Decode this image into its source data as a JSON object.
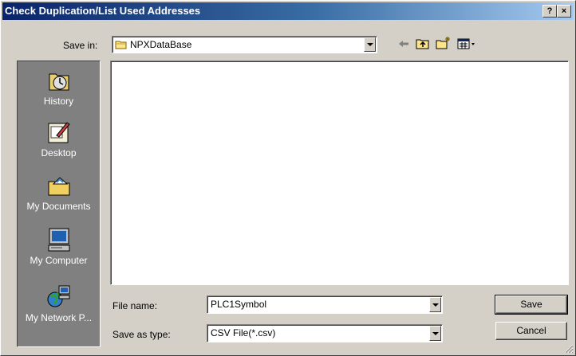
{
  "window": {
    "title": "Check Duplication/List Used Addresses",
    "help_button": "?",
    "close_button": "×"
  },
  "save_in": {
    "label": "Save in:",
    "value": "NPXDataBase",
    "icon": "folder-icon"
  },
  "toolbar": {
    "icons": [
      "back-arrow-icon",
      "up-one-level-icon",
      "new-folder-icon",
      "view-menu-icon"
    ]
  },
  "places": [
    {
      "label": "History",
      "icon": "history-icon"
    },
    {
      "label": "Desktop",
      "icon": "desktop-icon"
    },
    {
      "label": "My Documents",
      "icon": "my-documents-icon"
    },
    {
      "label": "My Computer",
      "icon": "my-computer-icon"
    },
    {
      "label": "My Network P...",
      "icon": "my-network-places-icon"
    }
  ],
  "file_name": {
    "label": "File name:",
    "value": "PLC1Symbol"
  },
  "save_as_type": {
    "label": "Save as type:",
    "value": "CSV File(*.csv)"
  },
  "buttons": {
    "save": "Save",
    "cancel": "Cancel"
  },
  "colors": {
    "title_start": "#0a246a",
    "title_end": "#a6caf0",
    "face": "#d4d0c8",
    "places_bg": "#808080"
  }
}
